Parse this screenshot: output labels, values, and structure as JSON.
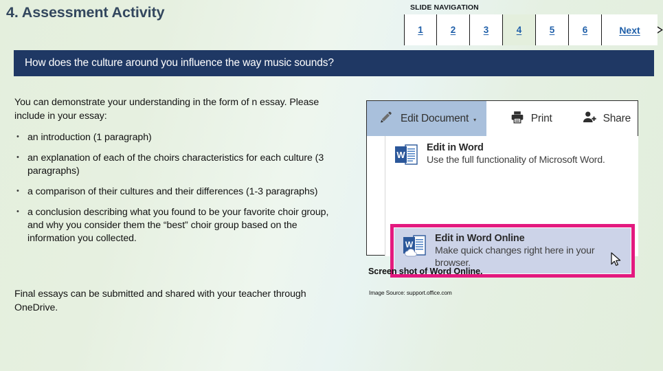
{
  "slide": {
    "title": "4. Assessment Activity",
    "question_banner": "How does the culture around you influence the way music sounds?"
  },
  "navigation": {
    "label_strong": "SLIDE",
    "label_rest": " NAVIGATION",
    "label_full": "SLIDE NAVIGATION",
    "active_slide": "4",
    "slides": [
      {
        "label": "1",
        "active": false
      },
      {
        "label": "2",
        "active": false
      },
      {
        "label": "3",
        "active": false
      },
      {
        "label": "4",
        "active": true
      },
      {
        "label": "5",
        "active": false
      },
      {
        "label": "6",
        "active": false
      }
    ],
    "next_label": "Next"
  },
  "body": {
    "intro": "You can demonstrate your understanding in the form of n essay. Please include in your essay:",
    "bullets": [
      "an introduction (1 paragraph)",
      "an explanation of each of the choirs characteristics for each culture (3 paragraphs)",
      "a comparison of their cultures and their differences (1-3 paragraphs)",
      "a conclusion describing what you found to be your favorite choir group, and why you consider them the “best” choir group based on the information you collected."
    ],
    "closing": "Final essays can be submitted and shared with your teacher through OneDrive."
  },
  "screenshot": {
    "toolbar": {
      "edit_document_label": "Edit Document",
      "edit_document_caret": "▾",
      "print_label": "Print",
      "share_label": "Share"
    },
    "menu_items": [
      {
        "title": "Edit in Word",
        "description": "Use the full functionality of Microsoft Word.",
        "icon": "word-document-icon",
        "highlighted": false
      },
      {
        "title": "Edit in Word Online",
        "description": "Make quick changes right here in your browser.",
        "icon": "word-online-cloud-icon",
        "highlighted": true
      }
    ],
    "caption": "Screen shot of Word Online.",
    "source": "Image Source: support.office.com"
  },
  "colors": {
    "page_background": "#e4efdd",
    "banner_navy": "#1f3864",
    "title_slate": "#33475e",
    "link_blue": "#1f5fa9",
    "active_cell": "#e4efdd",
    "highlight_magenta": "#e3197f",
    "toolbar_blue": "#a9c0dc",
    "selected_row_lavender": "#ccd3e8",
    "word_icon_blue": "#2b579a"
  }
}
